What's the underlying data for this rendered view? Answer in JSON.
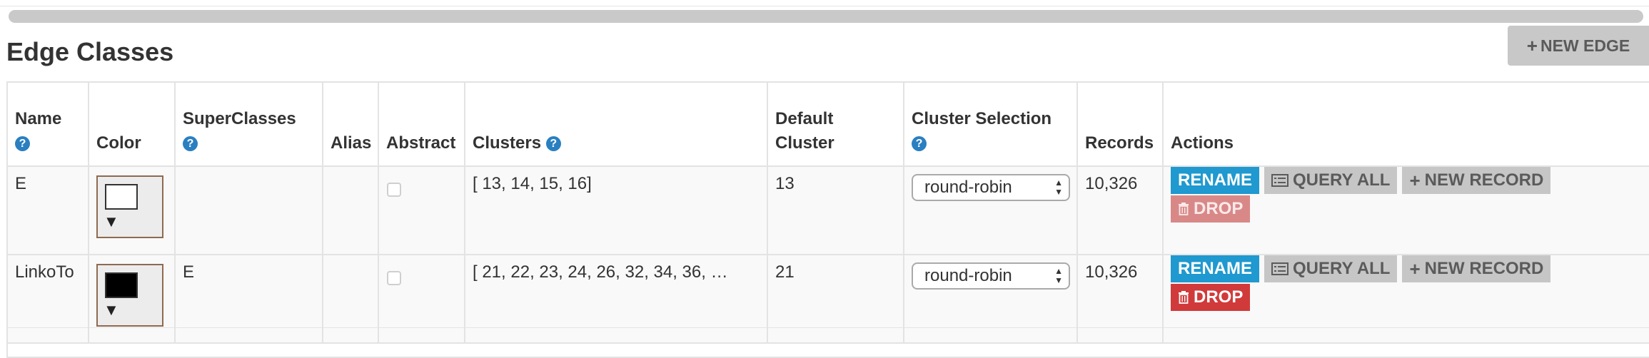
{
  "page": {
    "title": "Edge Classes",
    "new_edge_label": "NEW EDGE"
  },
  "table": {
    "headers": {
      "name": "Name",
      "color": "Color",
      "superclasses": "SuperClasses",
      "alias": "Alias",
      "abstract": "Abstract",
      "clusters": "Clusters",
      "default_cluster_1": "Default",
      "default_cluster_2": "Cluster",
      "cluster_selection": "Cluster Selection",
      "records": "Records",
      "actions": "Actions"
    },
    "help_glyph": "?",
    "rows": [
      {
        "name": "E",
        "color": "#ffffff",
        "superclasses": "",
        "alias": "",
        "abstract": false,
        "clusters": "[ 13, 14, 15, 16]",
        "default_cluster": "13",
        "cluster_selection": "round-robin",
        "records": "10,326",
        "drop_enabled": false
      },
      {
        "name": "LinkoTo",
        "color": "#000000",
        "superclasses": "E",
        "alias": "",
        "abstract": false,
        "clusters": "[ 21, 22, 23, 24, 26, 32, 34, 36, …",
        "default_cluster": "21",
        "cluster_selection": "round-robin",
        "records": "10,326",
        "drop_enabled": true
      }
    ],
    "action_labels": {
      "rename": "RENAME",
      "query_all": "QUERY ALL",
      "new_record": "NEW RECORD",
      "drop": "DROP"
    }
  },
  "colors": {
    "rename": "#1f99cf",
    "drop": "#d13a3a",
    "help_icon": "#2a7fc1"
  }
}
